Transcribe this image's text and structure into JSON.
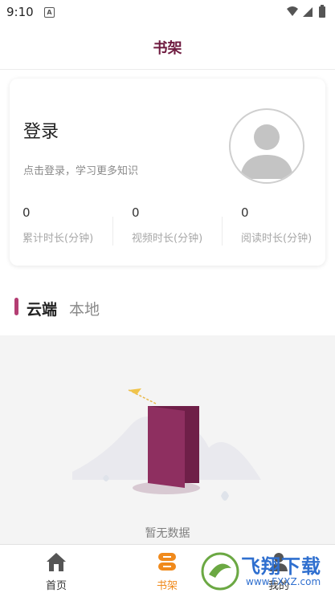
{
  "status_bar": {
    "time": "9:10",
    "notification_icon_letter": "A"
  },
  "header": {
    "title": "书架"
  },
  "profile_card": {
    "login_title": "登录",
    "login_subtitle": "点击登录，学习更多知识",
    "stats": [
      {
        "value": "0",
        "label": "累计时长(分钟)"
      },
      {
        "value": "0",
        "label": "视频时长(分钟)"
      },
      {
        "value": "0",
        "label": "阅读时长(分钟)"
      }
    ]
  },
  "shelf_tabs": {
    "active": "云端",
    "inactive": "本地",
    "accent_color": "#b43e73"
  },
  "empty_state": {
    "message": "暂无数据"
  },
  "bottom_nav": {
    "items": [
      {
        "label": "首页",
        "icon": "home-icon",
        "active": false
      },
      {
        "label": "书架",
        "icon": "bookshelf-icon",
        "active": true
      },
      {
        "label": "我的",
        "icon": "profile-icon",
        "active": false
      }
    ],
    "active_color": "#f08a1c",
    "inactive_color": "#333333"
  },
  "watermark": {
    "text": "飞翔下载",
    "url_text": "www.FXXZ.com"
  },
  "colors": {
    "title": "#6e1a3f",
    "book": "#8e2f60"
  }
}
